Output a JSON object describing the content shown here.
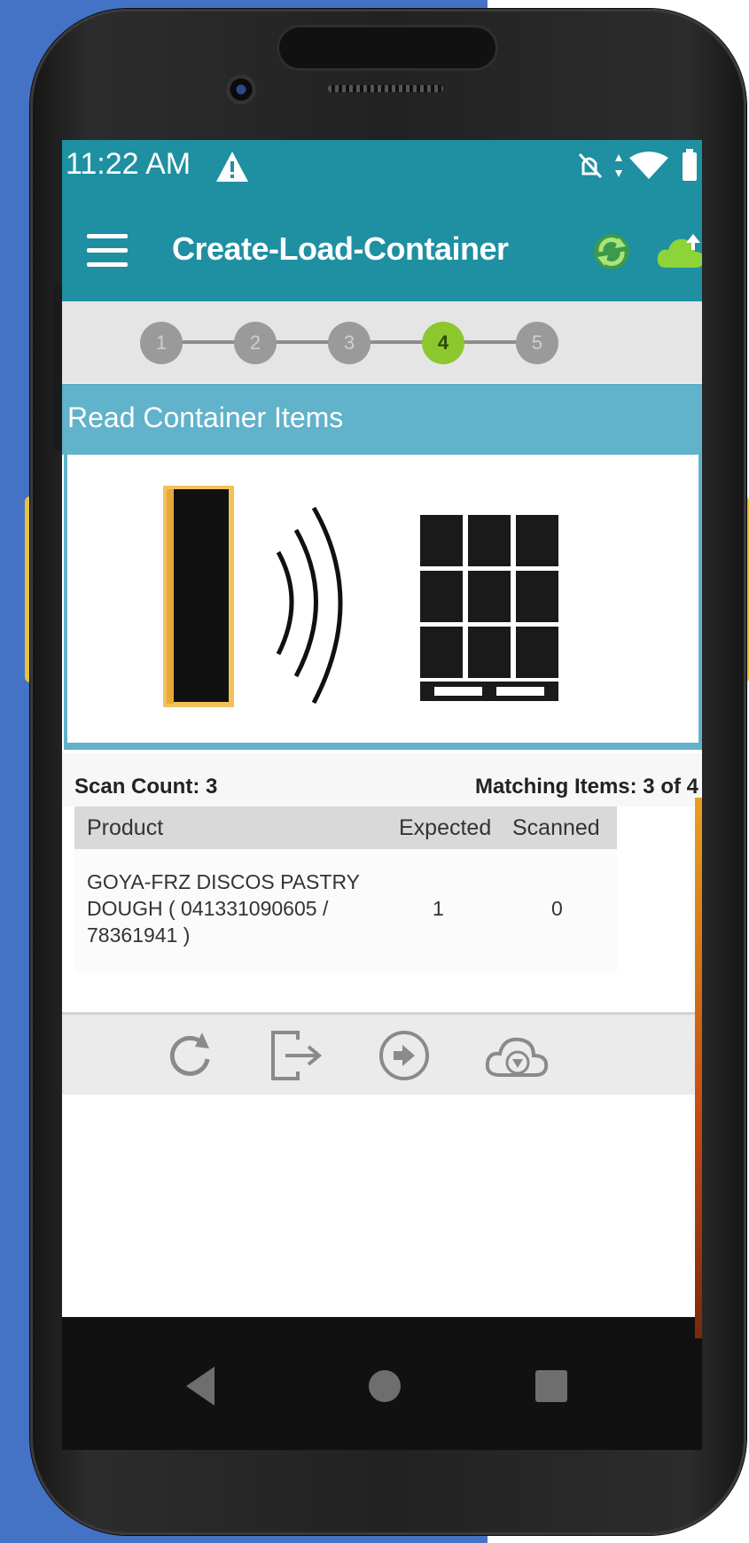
{
  "status_bar": {
    "time": "11:22 AM",
    "icons": [
      "warning-icon",
      "mute-icon",
      "data-arrows-icon",
      "wifi-icon",
      "battery-icon"
    ]
  },
  "app_bar": {
    "title": "Create-Load-Container",
    "icons": [
      "menu-icon",
      "sync-icon",
      "cloud-upload-icon"
    ]
  },
  "stepper": {
    "steps": [
      "1",
      "2",
      "3",
      "4",
      "5"
    ],
    "active_step": 4
  },
  "section": {
    "title": "Read Container Items"
  },
  "illustration": {
    "icons": [
      "rfid-reader-icon",
      "signal-waves-icon",
      "pallet-boxes-icon"
    ]
  },
  "counts": {
    "scan_count": "Scan Count: 3",
    "matching_items": "Matching Items: 3 of 4"
  },
  "table": {
    "headers": {
      "product": "Product",
      "expected": "Expected",
      "scanned": "Scanned"
    },
    "rows": [
      {
        "product": "GOYA-FRZ DISCOS PASTRY DOUGH ( 041331090605 / 78361941 )",
        "expected": "1",
        "scanned": "0"
      }
    ]
  },
  "toolbar": {
    "icons": [
      "refresh-icon",
      "exit-icon",
      "next-icon",
      "cloud-download-icon"
    ]
  },
  "nav_bar": {
    "icons": [
      "back-icon",
      "home-icon",
      "recents-icon"
    ]
  },
  "colors": {
    "app_bar": "#1f8fa2",
    "section_header": "#61b2cb",
    "active_step": "#8cc82d",
    "background": "#4472c4"
  }
}
